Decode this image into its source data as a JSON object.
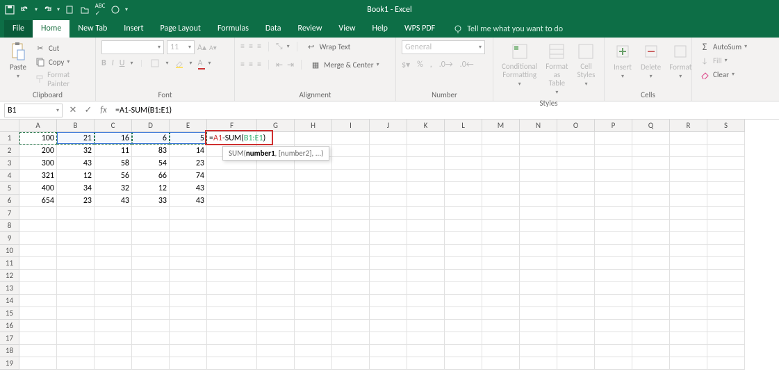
{
  "title": "Book1 - Excel",
  "qat": [
    "save-icon",
    "undo-icon",
    "redo-icon",
    "new-icon",
    "open-icon",
    "spellcheck-icon",
    "touch-icon",
    "customize-icon"
  ],
  "tabs": [
    "File",
    "Home",
    "New Tab",
    "Insert",
    "Page Layout",
    "Formulas",
    "Data",
    "Review",
    "View",
    "Help",
    "WPS PDF"
  ],
  "active_tab_index": 1,
  "tell_me": "Tell me what you want to do",
  "ribbon": {
    "clipboard": {
      "paste": "Paste",
      "cut": "Cut",
      "copy": "Copy",
      "painter": "Format Painter",
      "label": "Clipboard"
    },
    "font": {
      "name": "",
      "size": "11",
      "label": "Font",
      "bold": "B",
      "italic": "I",
      "underline": "U"
    },
    "alignment": {
      "wrap": "Wrap Text",
      "merge": "Merge & Center",
      "label": "Alignment"
    },
    "number": {
      "format": "General",
      "label": "Number"
    },
    "styles": {
      "cond": "Conditional Formatting",
      "table": "Format as Table",
      "cell": "Cell Styles",
      "label": "Styles"
    },
    "cells": {
      "insert": "Insert",
      "delete": "Delete",
      "format": "Format",
      "label": "Cells"
    },
    "editing": {
      "autosum": "AutoSum",
      "fill": "Fill",
      "clear": "Clear"
    }
  },
  "name_box": "B1",
  "formula": "=A1-SUM(B1:E1)",
  "tooltip_prefix": "SUM(",
  "tooltip_bold": "number1",
  "tooltip_suffix": ", [number2], ...)",
  "columns": [
    "A",
    "B",
    "C",
    "D",
    "E",
    "F",
    "G",
    "H",
    "I",
    "J",
    "K",
    "L",
    "M",
    "N",
    "O",
    "P",
    "Q",
    "R",
    "S"
  ],
  "row_count": 19,
  "cell_in_edit": {
    "col": "F",
    "row": 1,
    "text": "=A1-SUM(B1:E1)"
  },
  "marching_range": {
    "r": 1,
    "c1": "A",
    "c2": "E"
  },
  "blue_range": {
    "r": 1,
    "c1": "B",
    "c2": "E"
  },
  "data": {
    "1": {
      "A": "100",
      "B": "21",
      "C": "16",
      "D": "6",
      "E": "5"
    },
    "2": {
      "A": "200",
      "B": "32",
      "C": "11",
      "D": "83",
      "E": "14"
    },
    "3": {
      "A": "300",
      "B": "43",
      "C": "58",
      "D": "54",
      "E": "23"
    },
    "4": {
      "A": "321",
      "B": "12",
      "C": "56",
      "D": "66",
      "E": "74"
    },
    "5": {
      "A": "400",
      "B": "34",
      "C": "32",
      "D": "12",
      "E": "43"
    },
    "6": {
      "A": "654",
      "B": "23",
      "C": "43",
      "D": "33",
      "E": "43"
    }
  },
  "colors": {
    "brand": "#0d6e46",
    "accent": "#217346"
  }
}
